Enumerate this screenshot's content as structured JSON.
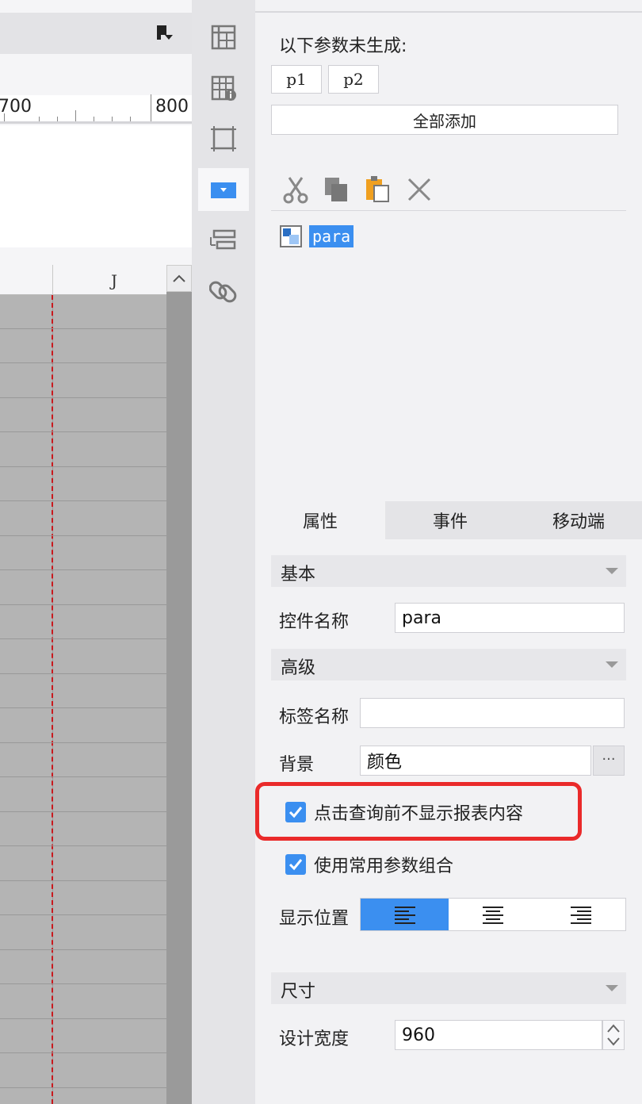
{
  "canvas": {
    "ruler_labels": [
      "700",
      "800"
    ],
    "column_label": "J"
  },
  "icon_bar": {
    "icons": [
      "frozen-pane-icon",
      "table-info-icon",
      "frame-icon",
      "dropdown-widget-icon",
      "widget-list-icon",
      "link-icon"
    ]
  },
  "params": {
    "title": "以下参数未生成:",
    "items": [
      "p1",
      "p2"
    ],
    "add_all_label": "全部添加"
  },
  "widget_tree": {
    "items": [
      {
        "label": "para",
        "selected": true
      }
    ]
  },
  "tabs": [
    "属性",
    "事件",
    "移动端"
  ],
  "properties": {
    "basic_title": "基本",
    "widget_name_label": "控件名称",
    "widget_name_value": "para",
    "advanced_title": "高级",
    "tag_name_label": "标签名称",
    "tag_name_value": "",
    "background_label": "背景",
    "background_value": "颜色",
    "background_more": "···",
    "checkbox_no_display_before_query": "点击查询前不显示报表内容",
    "checkbox_use_common_params": "使用常用参数组合",
    "display_position_label": "显示位置",
    "size_title": "尺寸",
    "design_width_label": "设计宽度",
    "design_width_value": "960"
  },
  "colors": {
    "accent": "#3b8ff0",
    "highlight": "#ea2a2a",
    "guide_line": "#c9191e"
  }
}
